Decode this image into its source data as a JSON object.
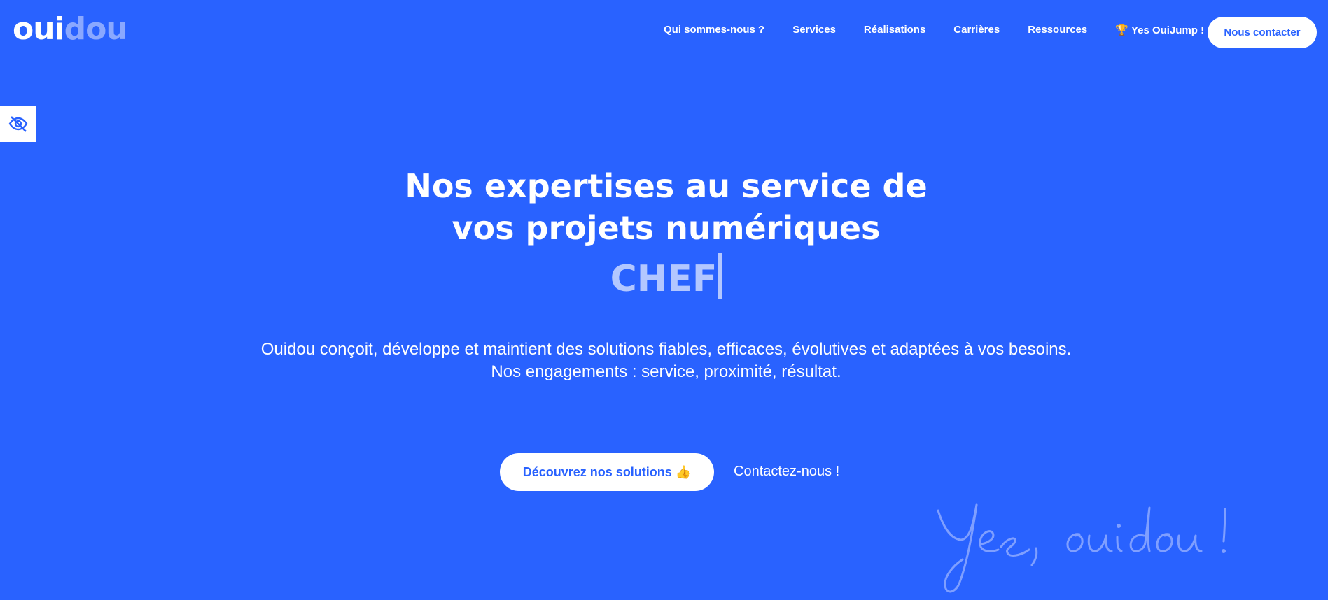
{
  "header": {
    "logo": {
      "part1": "oui",
      "part2": "dou"
    },
    "nav": [
      {
        "label": "Qui sommes-nous ?"
      },
      {
        "label": "Services"
      },
      {
        "label": "Réalisations"
      },
      {
        "label": "Carrières"
      },
      {
        "label": "Ressources"
      },
      {
        "label": "Yes OuiJump !",
        "icon": "trophy-icon"
      }
    ],
    "contact_button": "Nous contacter"
  },
  "accessibility": {
    "icon": "eye-slash-icon"
  },
  "hero": {
    "title_line1": "Nos expertises au service de",
    "title_line2": "vos projets numériques",
    "typed_word": "CHEF",
    "subtitle_line1": "Ouidou conçoit, développe et maintient des solutions fiables, efficaces, évolutives et adaptées à vos besoins.",
    "subtitle_line2": "Nos engagements : service, proximité, résultat.",
    "cta_primary": "Découvrez nos solutions 👍",
    "cta_secondary": "Contactez-nous !"
  },
  "signature": {
    "text": "Yes, ouidou !"
  },
  "colors": {
    "background": "#2962ff",
    "accent_light": "#b3c7ff",
    "white": "#ffffff"
  }
}
